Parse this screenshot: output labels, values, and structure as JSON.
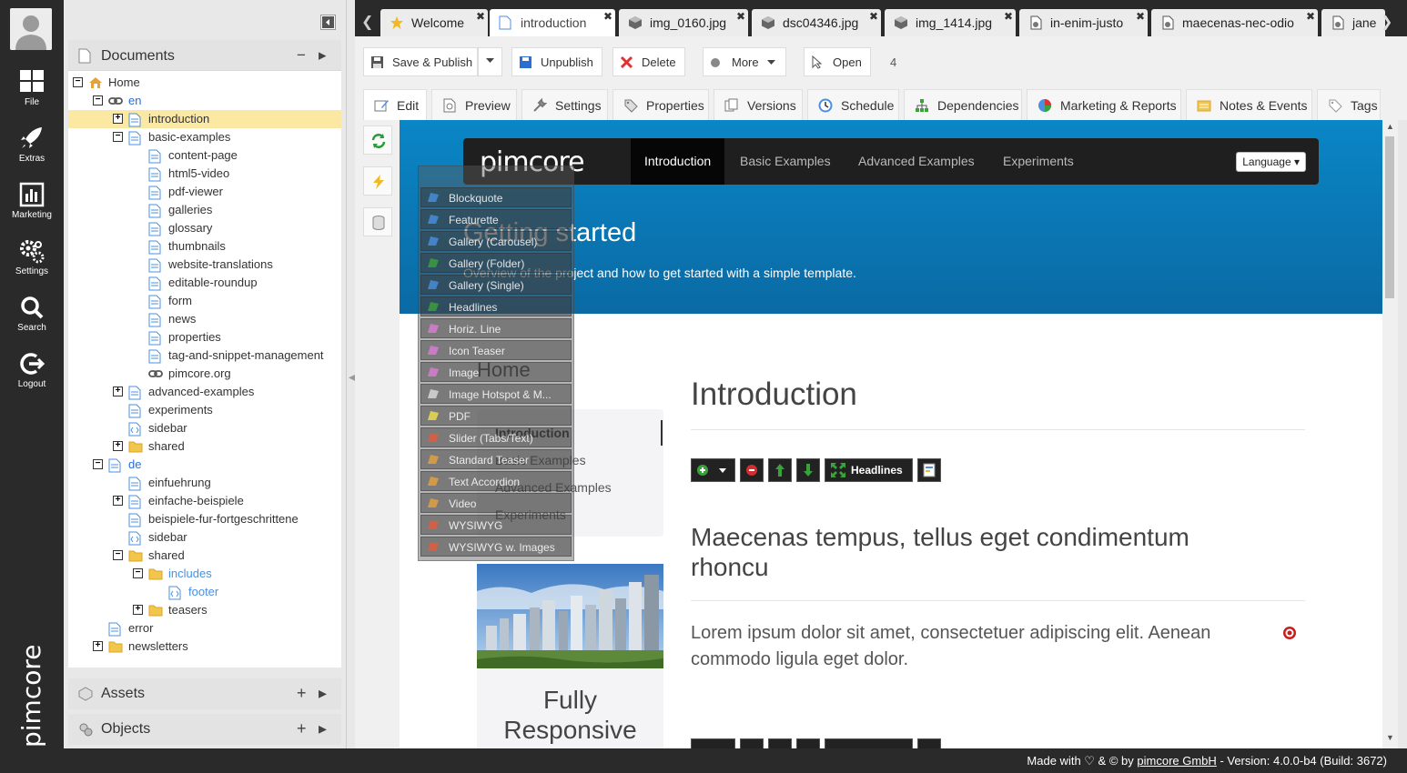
{
  "iconbar": {
    "items": [
      {
        "label": "File",
        "icon": "file-grid-icon"
      },
      {
        "label": "Extras",
        "icon": "rocket-icon"
      },
      {
        "label": "Marketing",
        "icon": "chart-icon"
      },
      {
        "label": "Settings",
        "icon": "gears-icon"
      },
      {
        "label": "Search",
        "icon": "search-icon"
      },
      {
        "label": "Logout",
        "icon": "logout-icon"
      }
    ],
    "brand": "pimcore"
  },
  "documents": {
    "title": "Documents",
    "collapse": "−",
    "expand": "▸",
    "tree": [
      {
        "label": "Home",
        "level": 0,
        "exp": "-",
        "icon": "home"
      },
      {
        "label": "en",
        "level": 1,
        "exp": "-",
        "icon": "link",
        "style": "link"
      },
      {
        "label": "introduction",
        "level": 2,
        "exp": "+",
        "icon": "page",
        "selected": true
      },
      {
        "label": "basic-examples",
        "level": 2,
        "exp": "-",
        "icon": "page"
      },
      {
        "label": "content-page",
        "level": 3,
        "icon": "page"
      },
      {
        "label": "html5-video",
        "level": 3,
        "icon": "page"
      },
      {
        "label": "pdf-viewer",
        "level": 3,
        "icon": "page"
      },
      {
        "label": "galleries",
        "level": 3,
        "icon": "page"
      },
      {
        "label": "glossary",
        "level": 3,
        "icon": "page"
      },
      {
        "label": "thumbnails",
        "level": 3,
        "icon": "page"
      },
      {
        "label": "website-translations",
        "level": 3,
        "icon": "page"
      },
      {
        "label": "editable-roundup",
        "level": 3,
        "icon": "page"
      },
      {
        "label": "form",
        "level": 3,
        "icon": "page"
      },
      {
        "label": "news",
        "level": 3,
        "icon": "page"
      },
      {
        "label": "properties",
        "level": 3,
        "icon": "page"
      },
      {
        "label": "tag-and-snippet-management",
        "level": 3,
        "icon": "page"
      },
      {
        "label": "pimcore.org",
        "level": 3,
        "icon": "link"
      },
      {
        "label": "advanced-examples",
        "level": 2,
        "exp": "+",
        "icon": "page"
      },
      {
        "label": "experiments",
        "level": 2,
        "icon": "page"
      },
      {
        "label": "sidebar",
        "level": 2,
        "icon": "snippet"
      },
      {
        "label": "shared",
        "level": 2,
        "exp": "+",
        "icon": "folder"
      },
      {
        "label": "de",
        "level": 1,
        "exp": "-",
        "icon": "page",
        "style": "link"
      },
      {
        "label": "einfuehrung",
        "level": 2,
        "icon": "page"
      },
      {
        "label": "einfache-beispiele",
        "level": 2,
        "exp": "+",
        "icon": "page"
      },
      {
        "label": "beispiele-fur-fortgeschrittene",
        "level": 2,
        "icon": "page"
      },
      {
        "label": "sidebar",
        "level": 2,
        "icon": "snippet"
      },
      {
        "label": "shared",
        "level": 2,
        "exp": "-",
        "icon": "folder"
      },
      {
        "label": "includes",
        "level": 3,
        "exp": "-",
        "icon": "folder",
        "style": "inc"
      },
      {
        "label": "footer",
        "level": 4,
        "icon": "snippet",
        "style": "dim"
      },
      {
        "label": "teasers",
        "level": 3,
        "exp": "+",
        "icon": "folder"
      },
      {
        "label": "error",
        "level": 1,
        "icon": "page"
      },
      {
        "label": "newsletters",
        "level": 1,
        "exp": "+",
        "icon": "folder"
      }
    ]
  },
  "assets": {
    "title": "Assets",
    "add": "+",
    "expand": "▸"
  },
  "objects": {
    "title": "Objects",
    "add": "+",
    "expand": "▸"
  },
  "tabs": [
    {
      "label": "Welcome",
      "icon": "star"
    },
    {
      "label": "introduction",
      "icon": "page",
      "active": true
    },
    {
      "label": "img_0160.jpg",
      "icon": "cube"
    },
    {
      "label": "dsc04346.jpg",
      "icon": "cube"
    },
    {
      "label": "img_1414.jpg",
      "icon": "cube"
    },
    {
      "label": "in-enim-justo",
      "icon": "obj"
    },
    {
      "label": "maecenas-nec-odio",
      "icon": "obj"
    },
    {
      "label": "jane",
      "icon": "obj"
    }
  ],
  "tab_close": "✖",
  "toolbar": {
    "save_publish": "Save & Publish",
    "unpublish": "Unpublish",
    "delete": "Delete",
    "more": "More",
    "open": "Open",
    "id": "4"
  },
  "subtabs": [
    {
      "label": "Edit",
      "active": true
    },
    {
      "label": "Preview"
    },
    {
      "label": "Settings"
    },
    {
      "label": "Properties"
    },
    {
      "label": "Versions"
    },
    {
      "label": "Schedule"
    },
    {
      "label": "Dependencies"
    },
    {
      "label": "Marketing & Reports"
    },
    {
      "label": "Notes & Events"
    },
    {
      "label": "Tags"
    }
  ],
  "site": {
    "logo": "pimcore",
    "nav": [
      "Introduction",
      "Basic Examples",
      "Advanced Examples",
      "Experiments"
    ],
    "language": "Language",
    "hero_title": "Getting started",
    "hero_sub": "Overview of the project and how to get started with a simple template.",
    "side_home": "Home",
    "side_items": [
      "Introduction",
      "Basic Examples",
      "Advanced Examples",
      "Experiments"
    ],
    "full_responsive": "Fully Responsive",
    "h1": "Introduction",
    "area_label": "Headlines",
    "h2": "Maecenas tempus, tellus eget condimentum rhoncu",
    "para": "Lorem ipsum dolor sit amet, consectetuer adipiscing elit. Aenean commodo ligula eget dolor."
  },
  "bricks": [
    "Blockquote",
    "Featurette",
    "Gallery (Carousel)",
    "Gallery (Folder)",
    "Gallery (Single)",
    "Headlines",
    "Horiz. Line",
    "Icon Teaser",
    "Image",
    "Image Hotspot & M...",
    "PDF",
    "Slider (Tabs/Text)",
    "Standard Teaser",
    "Text Accordion",
    "Video",
    "WYSIWYG",
    "WYSIWYG w. Images"
  ],
  "footer": {
    "made_with": "Made with ♡ & © by",
    "company": "pimcore GmbH",
    "version": "- Version: 4.0.0-b4 (Build: 3672)"
  }
}
